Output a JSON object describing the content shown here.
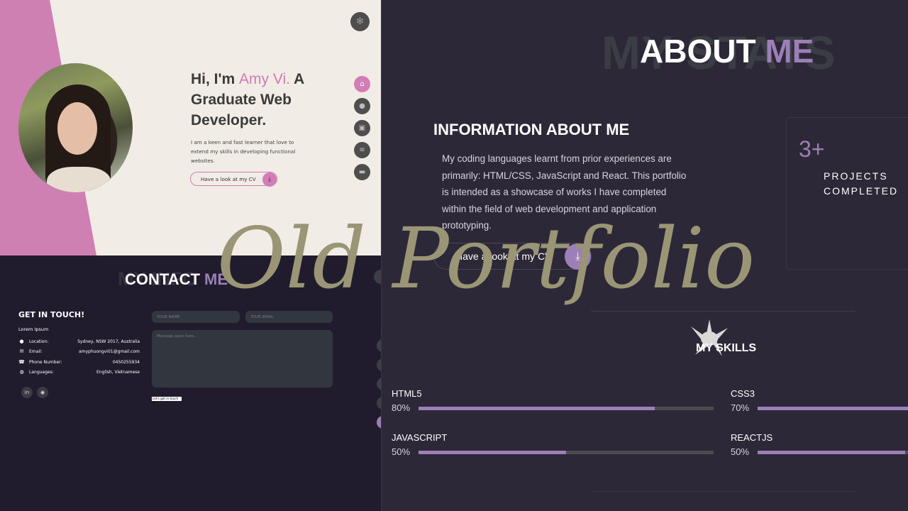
{
  "hero": {
    "greeting_prefix": "Hi, I'm ",
    "name": "Amy Vi.",
    "greeting_suffix": " A Graduate Web Developer.",
    "intro": "I am a keen and fast learner that love to extend my skills in developing functional websites.",
    "cv_button": "Have a look at my CV",
    "icons": {
      "settings": "gear-icon",
      "download": "download-icon"
    },
    "nav": [
      {
        "icon": "home-icon",
        "glyph": "⌂",
        "active": true
      },
      {
        "icon": "user-icon",
        "glyph": "●",
        "active": false
      },
      {
        "icon": "briefcase-icon",
        "glyph": "▣",
        "active": false
      },
      {
        "icon": "list-icon",
        "glyph": "≡",
        "active": false
      },
      {
        "icon": "comment-icon",
        "glyph": "▬",
        "active": false
      }
    ],
    "colors": {
      "accent": "#d37db6",
      "background": "#f1ece5"
    }
  },
  "about": {
    "ghost_title": "MY STATS",
    "title_main": "ABOUT",
    "title_accent": "ME",
    "info_heading": "INFORMATION ABOUT ME",
    "info_text": "My coding languages learnt from prior experiences are primarily: HTML/CSS, JavaScript and React. This portfolio is intended as a showcase of works I have completed within the field of web development and application prototyping.",
    "cv_button": "Have a look at my CV",
    "stat": {
      "number": "3+",
      "label": "PROJECTS COMPLETED"
    },
    "skills_heading": "MY SKILLS",
    "skills": [
      {
        "name": "HTML5",
        "percent_label": "80%",
        "value": 0.8
      },
      {
        "name": "CSS3",
        "percent_label": "70%",
        "value": 0.7
      },
      {
        "name": "JAVASCRIPT",
        "percent_label": "50%",
        "value": 0.5
      },
      {
        "name": "REACTJS",
        "percent_label": "50%",
        "value": 0.5
      }
    ],
    "colors": {
      "accent": "#9b7fb6",
      "background": "#2d2837"
    }
  },
  "contact": {
    "title_main": "CONTACT",
    "title_accent": "ME",
    "get_in_touch": "GET IN TOUCH!",
    "lorem": "Lorem Ipsum",
    "rows": [
      {
        "icon": "location-pin-icon",
        "glyph": "●",
        "key": "Location:",
        "value": "Sydney, NSW 2017, Australia"
      },
      {
        "icon": "envelope-icon",
        "glyph": "✉",
        "key": "Email:",
        "value": "amyphuongvi01@gmail.com"
      },
      {
        "icon": "phone-icon",
        "glyph": "☎",
        "key": "Phone Number:",
        "value": "0450255934"
      },
      {
        "icon": "globe-icon",
        "glyph": "◍",
        "key": "Languages:",
        "value": "English, Vietnamese"
      }
    ],
    "social": [
      {
        "icon": "linkedin-icon",
        "glyph": "in"
      },
      {
        "icon": "github-icon",
        "glyph": "◉"
      }
    ],
    "name_placeholder": "YOUR NAME",
    "email_placeholder": "YOUR EMAIL",
    "message_placeholder": "Message goes here...",
    "send_button": "Let's get in touch ✉"
  },
  "overlay_title": "Old Portfolio"
}
